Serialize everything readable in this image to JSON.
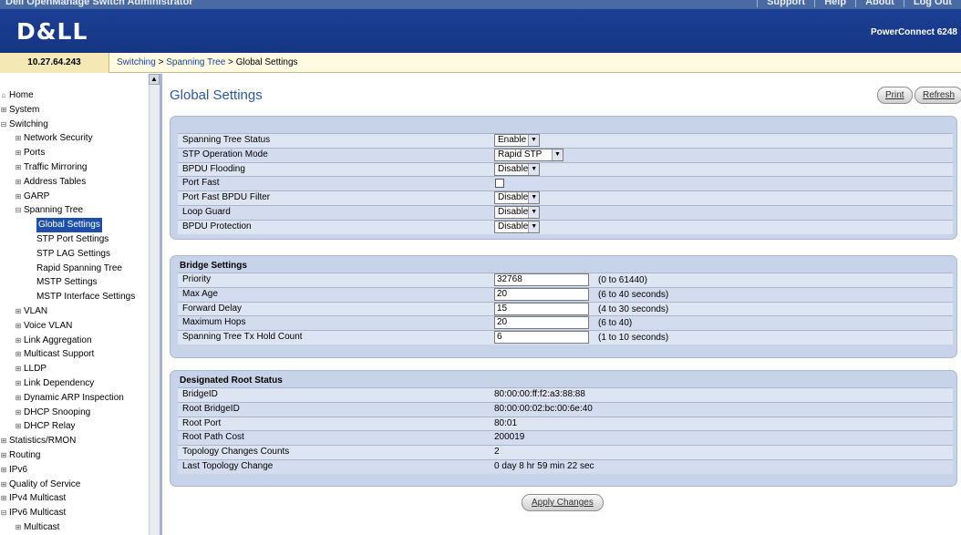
{
  "topbar": {
    "app_title": "Dell OpenManage Switch Administrator",
    "links": [
      "Support",
      "Help",
      "About",
      "Log Out"
    ]
  },
  "header": {
    "logo": "D&LL",
    "product": "PowerConnect 6248"
  },
  "address": {
    "ip": "10.27.64.243",
    "breadcrumb_links": [
      "Switching",
      "Spanning Tree"
    ],
    "breadcrumb_sep": " > ",
    "breadcrumb_current": "Global Settings"
  },
  "sidebar": {
    "items": [
      {
        "label": "Home",
        "level": 0,
        "icon": "home-icon"
      },
      {
        "label": "System",
        "level": 0,
        "icon": "expand"
      },
      {
        "label": "Switching",
        "level": 0,
        "icon": "collapse"
      },
      {
        "label": "Network Security",
        "level": 1,
        "icon": "expand"
      },
      {
        "label": "Ports",
        "level": 1,
        "icon": "expand"
      },
      {
        "label": "Traffic Mirroring",
        "level": 1,
        "icon": "expand"
      },
      {
        "label": "Address Tables",
        "level": 1,
        "icon": "expand"
      },
      {
        "label": "GARP",
        "level": 1,
        "icon": "expand"
      },
      {
        "label": "Spanning Tree",
        "level": 1,
        "icon": "collapse"
      },
      {
        "label": "Global Settings",
        "level": 2,
        "icon": "",
        "selected": true
      },
      {
        "label": "STP Port Settings",
        "level": 2,
        "icon": ""
      },
      {
        "label": "STP LAG Settings",
        "level": 2,
        "icon": ""
      },
      {
        "label": "Rapid Spanning Tree",
        "level": 2,
        "icon": ""
      },
      {
        "label": "MSTP Settings",
        "level": 2,
        "icon": ""
      },
      {
        "label": "MSTP Interface Settings",
        "level": 2,
        "icon": ""
      },
      {
        "label": "VLAN",
        "level": 1,
        "icon": "expand"
      },
      {
        "label": "Voice VLAN",
        "level": 1,
        "icon": "expand"
      },
      {
        "label": "Link Aggregation",
        "level": 1,
        "icon": "expand"
      },
      {
        "label": "Multicast Support",
        "level": 1,
        "icon": "expand"
      },
      {
        "label": "LLDP",
        "level": 1,
        "icon": "expand"
      },
      {
        "label": "Link Dependency",
        "level": 1,
        "icon": "expand"
      },
      {
        "label": "Dynamic ARP Inspection",
        "level": 1,
        "icon": "expand"
      },
      {
        "label": "DHCP Snooping",
        "level": 1,
        "icon": "expand"
      },
      {
        "label": "DHCP Relay",
        "level": 1,
        "icon": "expand"
      },
      {
        "label": "Statistics/RMON",
        "level": 0,
        "icon": "expand"
      },
      {
        "label": "Routing",
        "level": 0,
        "icon": "expand"
      },
      {
        "label": "IPv6",
        "level": 0,
        "icon": "expand"
      },
      {
        "label": "Quality of Service",
        "level": 0,
        "icon": "expand"
      },
      {
        "label": "IPv4 Multicast",
        "level": 0,
        "icon": "expand"
      },
      {
        "label": "IPv6 Multicast",
        "level": 0,
        "icon": "collapse"
      },
      {
        "label": "Multicast",
        "level": 1,
        "icon": "expand"
      }
    ]
  },
  "main": {
    "title": "Global Settings",
    "print_label": "Print",
    "refresh_label": "Refresh",
    "global_rows": [
      {
        "label": "Spanning Tree Status",
        "type": "select",
        "value": "Enable"
      },
      {
        "label": "STP Operation Mode",
        "type": "select",
        "value": "Rapid STP"
      },
      {
        "label": "BPDU Flooding",
        "type": "select",
        "value": "Disable"
      },
      {
        "label": "Port Fast",
        "type": "checkbox",
        "value": "unchecked"
      },
      {
        "label": "Port Fast BPDU Filter",
        "type": "select",
        "value": "Disable"
      },
      {
        "label": "Loop Guard",
        "type": "select",
        "value": "Disable"
      },
      {
        "label": "BPDU Protection",
        "type": "select",
        "value": "Disable"
      }
    ],
    "bridge": {
      "title": "Bridge Settings",
      "rows": [
        {
          "label": "Priority",
          "value": "32768",
          "range": "(0 to 61440)"
        },
        {
          "label": "Max Age",
          "value": "20",
          "range": "(6 to 40 seconds)"
        },
        {
          "label": "Forward Delay",
          "value": "15",
          "range": "(4 to 30 seconds)"
        },
        {
          "label": "Maximum Hops",
          "value": "20",
          "range": "(6 to 40)"
        },
        {
          "label": "Spanning Tree Tx Hold Count",
          "value": "6",
          "range": "(1 to 10 seconds)"
        }
      ]
    },
    "root": {
      "title": "Designated Root Status",
      "rows": [
        {
          "label": "BridgeID",
          "value": "80:00:00:ff:f2:a3:88:88"
        },
        {
          "label": "Root BridgeID",
          "value": "80:00:00:02:bc:00:6e:40"
        },
        {
          "label": "Root Port",
          "value": "80:01"
        },
        {
          "label": "Root Path Cost",
          "value": "200019"
        },
        {
          "label": "Topology Changes Counts",
          "value": "2"
        },
        {
          "label": "Last Topology Change",
          "value": "0 day 8 hr 59 min 22 sec"
        }
      ]
    },
    "apply_label": "Apply Changes"
  }
}
